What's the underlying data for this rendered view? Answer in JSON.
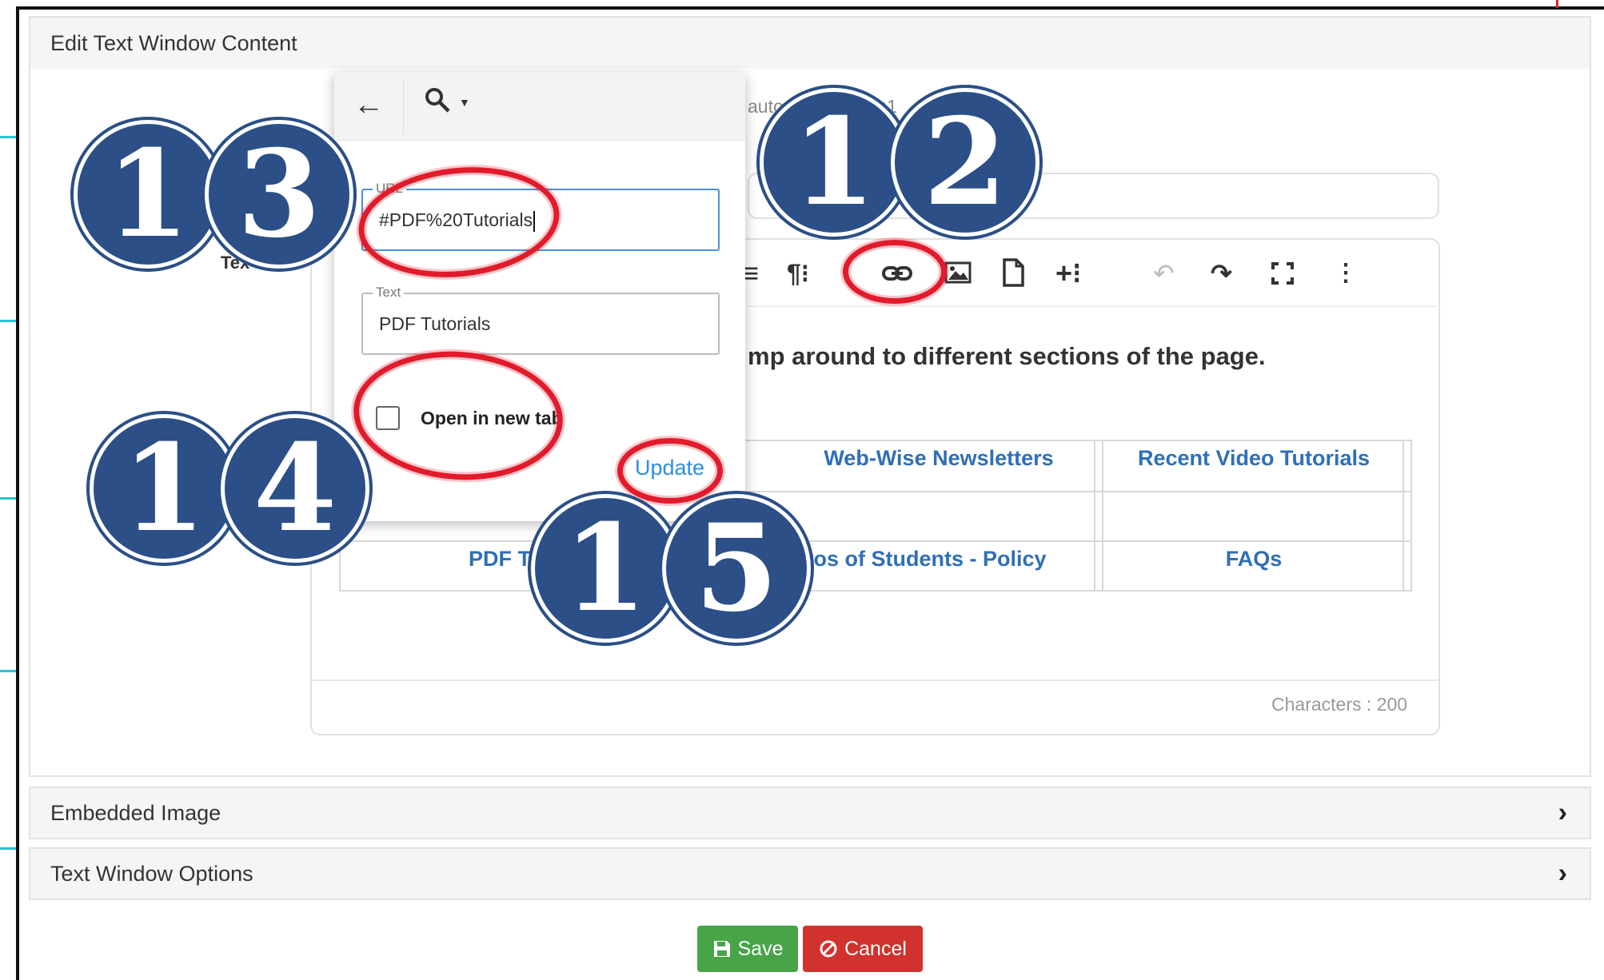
{
  "panels": {
    "main_title": "Edit Text Window Content",
    "embedded_image": "Embedded Image",
    "text_window_options": "Text Window Options"
  },
  "background": {
    "url_partial": "auto",
    "url_partial_2": "5:1",
    "text_label_partial": "Tex",
    "heading_partial": "mp around to different sections of the page.",
    "characters": "Characters : 200"
  },
  "toolbar": {
    "icons": [
      "align-icon",
      "paragraph-icon",
      "link-icon",
      "image-icon",
      "file-icon",
      "insert-icon",
      "undo-icon",
      "redo-icon",
      "fullscreen-icon",
      "more-icon"
    ]
  },
  "table": {
    "r1c2": "Web-Wise Newsletters",
    "r1c3": "Recent Video Tutorials",
    "r3c1": "PDF T",
    "r3c2": "otos of Students - Policy",
    "r3c3": "FAQs"
  },
  "popup": {
    "url_legend": "URL",
    "url_value": "#PDF%20Tutorials",
    "text_legend": "Text",
    "text_value": "PDF Tutorials",
    "open_new_tab": "Open in new tab",
    "update": "Update"
  },
  "badges": {
    "b12": "12",
    "b13": "13",
    "b14": "14",
    "b15": "15"
  },
  "buttons": {
    "save": "Save",
    "cancel": "Cancel"
  },
  "colors": {
    "badge": "#2b4f86",
    "annotation_red": "#e11b2b",
    "link_blue": "#2f6fb5",
    "save_green": "#47a447",
    "cancel_red": "#d2322d"
  }
}
